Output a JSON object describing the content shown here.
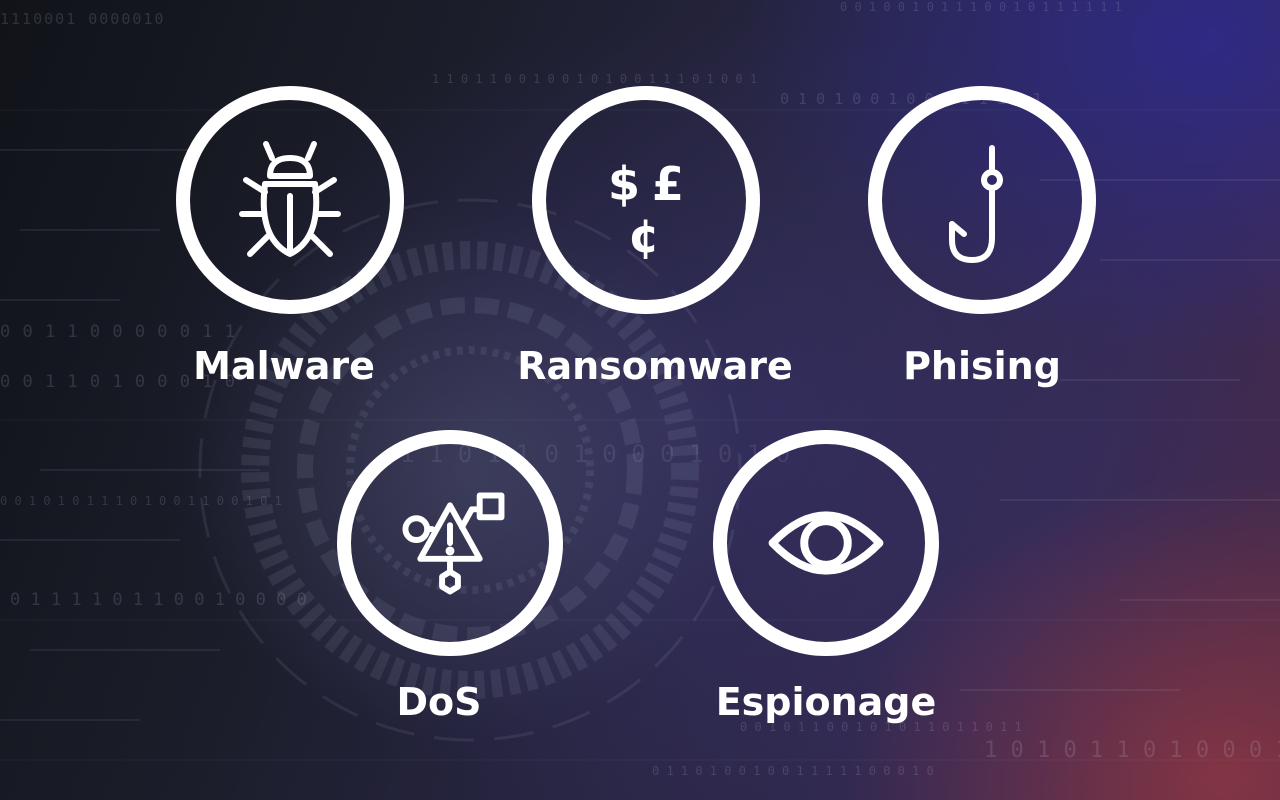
{
  "threats": [
    {
      "label": "Malware",
      "icon": "bug-icon"
    },
    {
      "label": "Ransomware",
      "icon": "currency-icon"
    },
    {
      "label": "Phising",
      "icon": "fish-hook-icon"
    },
    {
      "label": "DoS",
      "icon": "network-warning-icon"
    },
    {
      "label": "Espionage",
      "icon": "eye-icon"
    }
  ],
  "currency_symbols": {
    "dollar": "$",
    "pound": "£",
    "cent": "¢"
  },
  "background_digits": [
    "1110001 0000010",
    "1 1 0 1 1 0 0 1 0 0 1 0 1 0 0 1 1 1 0 1 0 0 1",
    "0 1 0 1 0 0 1 0 0 1 1 1 1 1 1",
    "0 0 1 1 0 0 0 0 0 1 1",
    "0 0 1 1 0 1 0 0 0 1 0",
    "1 1 0 1 1 0 1 0 0 0 1 0 1 0",
    "0 1 1 1 1 0 1 1 0 0 1 0 0 0 0",
    "0 0 1 0 1 0 1 1 1 0 1 0 0 1 1 0 0 1 0 1",
    "1 0 1 0 1 1 0 1 0 0 0 1",
    "0 0 1 0 1 1 0 0 1 0 1 0 1 1 0 1 1 0 1 1",
    "0 1 1 0 1 0 0 1 0 0 1 1 1 1 1 0 0 0 1 0",
    "0 0 1 0 0 1 0 1 1 1 0 0 1 0 1 1 1 1 1 1"
  ],
  "colors": {
    "foreground": "#ffffff",
    "accent_red": "#a83a3e",
    "accent_blue": "#2c2a96"
  }
}
